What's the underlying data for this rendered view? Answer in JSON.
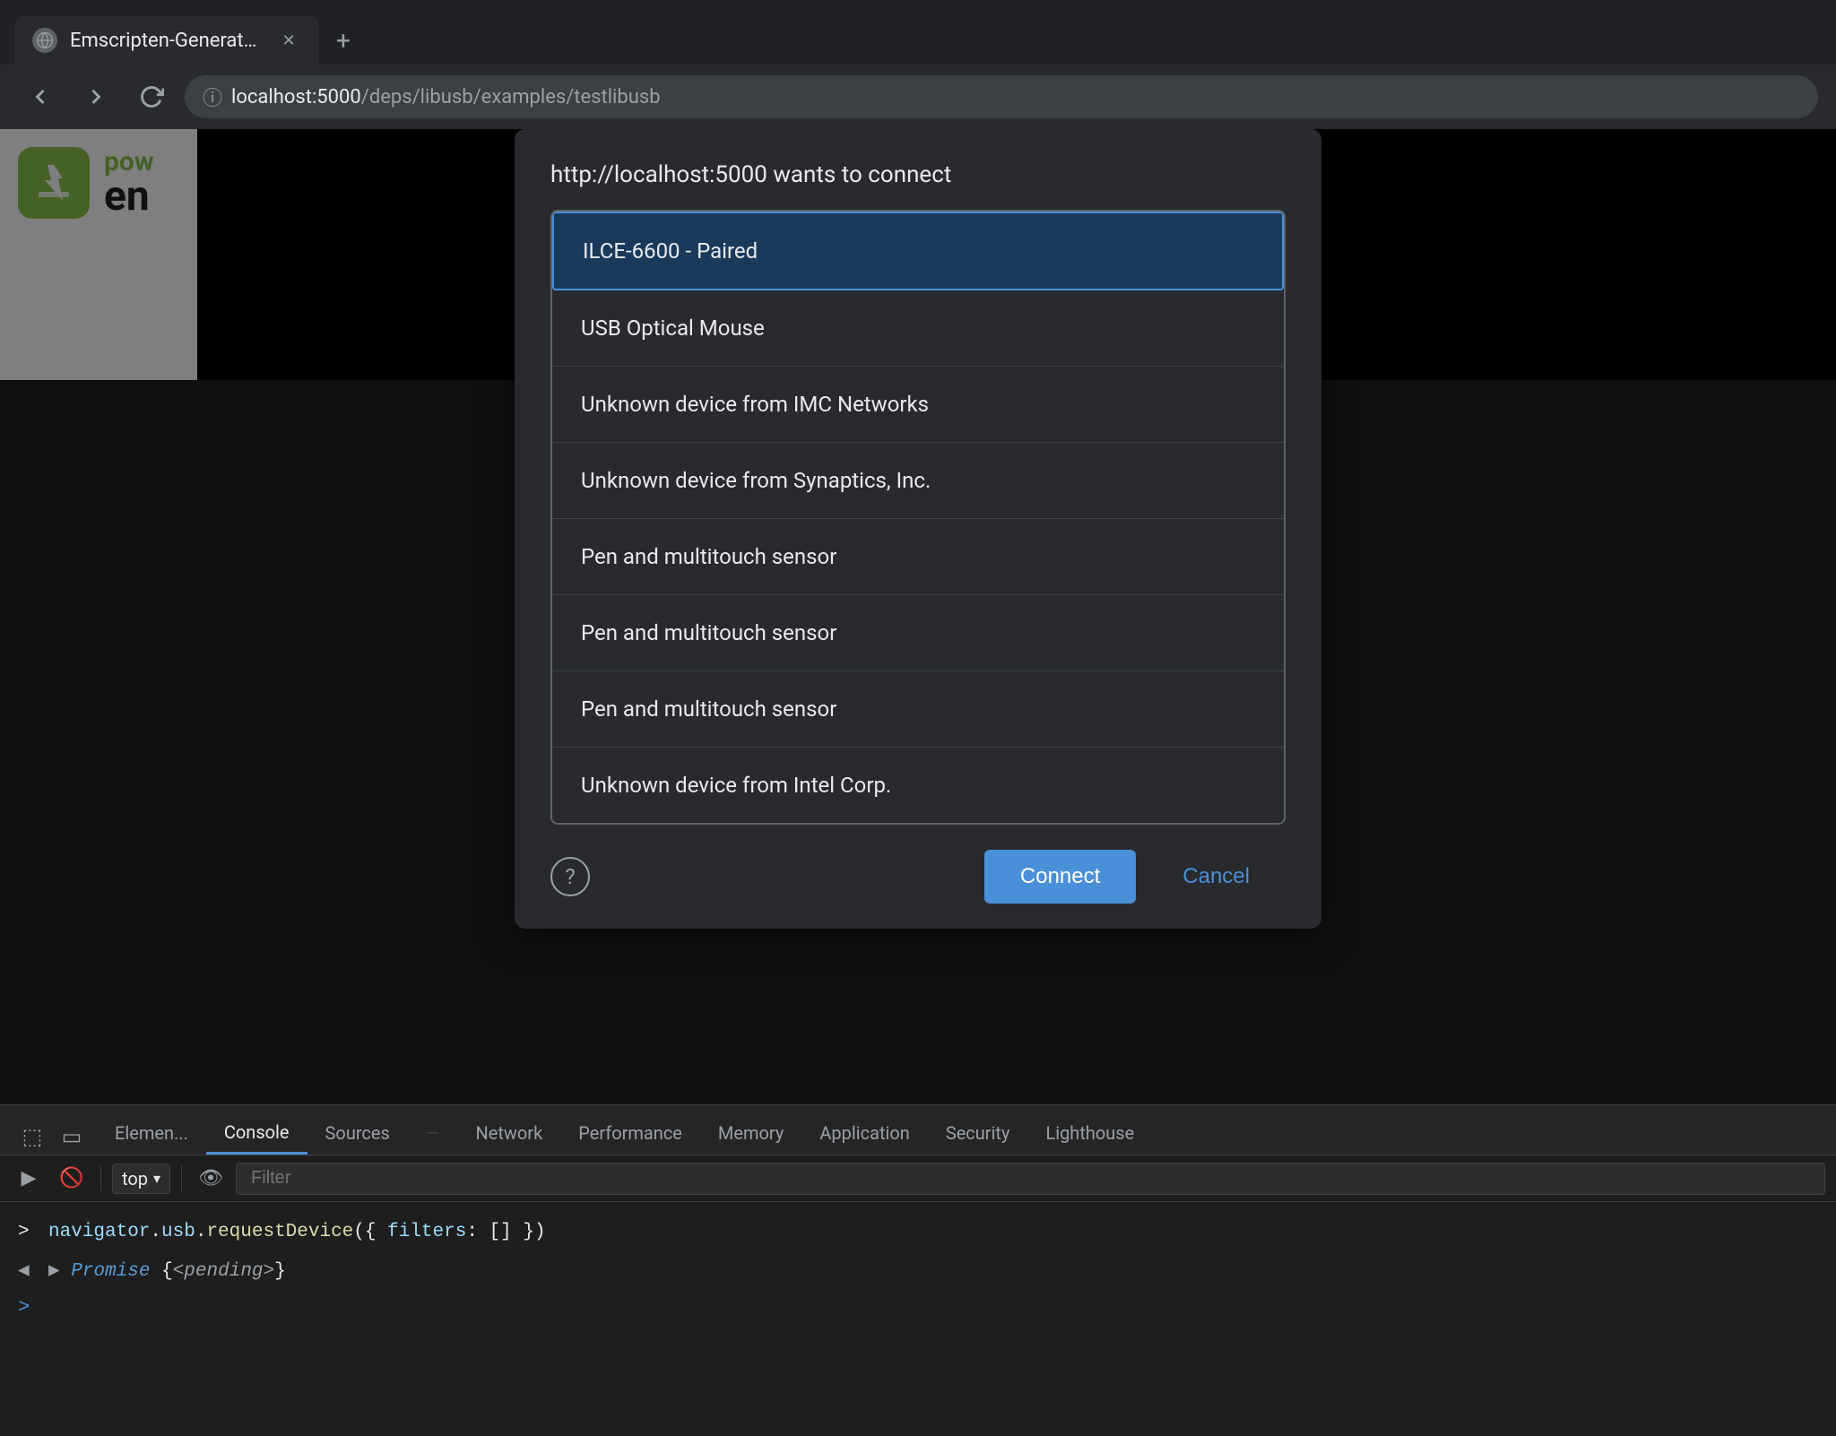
{
  "browser": {
    "tab": {
      "title": "Emscripten-Generated Code",
      "favicon": "globe"
    },
    "new_tab_label": "+",
    "nav": {
      "back_title": "back",
      "forward_title": "forward",
      "reload_title": "reload",
      "url": "localhost:5000/deps/libusb/examples/testlibusb"
    }
  },
  "dialog": {
    "title": "http://localhost:5000 wants to connect",
    "devices": [
      {
        "label": "ILCE-6600 - Paired",
        "selected": true
      },
      {
        "label": "USB Optical Mouse",
        "selected": false
      },
      {
        "label": "Unknown device from IMC Networks",
        "selected": false
      },
      {
        "label": "Unknown device from Synaptics, Inc.",
        "selected": false
      },
      {
        "label": "Pen and multitouch sensor",
        "selected": false
      },
      {
        "label": "Pen and multitouch sensor",
        "selected": false
      },
      {
        "label": "Pen and multitouch sensor",
        "selected": false
      },
      {
        "label": "Unknown device from Intel Corp.",
        "selected": false
      }
    ],
    "connect_btn": "Connect",
    "cancel_btn": "Cancel"
  },
  "devtools": {
    "tabs": [
      {
        "label": "Elements",
        "active": false
      },
      {
        "label": "Console",
        "active": true
      },
      {
        "label": "Sources",
        "active": false
      },
      {
        "label": "Network",
        "active": false
      },
      {
        "label": "Performance",
        "active": false
      },
      {
        "label": "Memory",
        "active": false
      },
      {
        "label": "Application",
        "active": false
      },
      {
        "label": "Security",
        "active": false
      },
      {
        "label": "Lighthouse",
        "active": false
      }
    ],
    "toolbar": {
      "top_label": "top",
      "filter_placeholder": "Filter"
    },
    "console": {
      "line1": "navigator.usb.requestDevice({ filters: [] })",
      "line2_prefix": "Promise",
      "line2_suffix": "{<pending>}"
    }
  },
  "page": {
    "logo": {
      "pow_text": "pow",
      "en_text": "en"
    }
  }
}
